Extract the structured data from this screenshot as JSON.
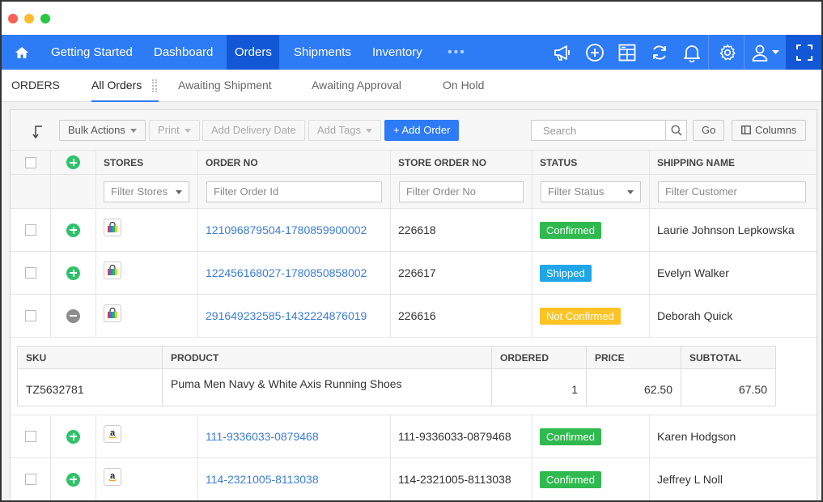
{
  "nav": {
    "items": [
      {
        "label": "Getting Started"
      },
      {
        "label": "Dashboard"
      },
      {
        "label": "Orders"
      },
      {
        "label": "Shipments"
      },
      {
        "label": "Inventory"
      }
    ],
    "more": "•••",
    "active": "Orders",
    "icons": [
      "megaphone-icon",
      "add-circle-icon",
      "calculator-icon",
      "sync-icon",
      "bell-icon",
      "gear-icon",
      "user-icon",
      "fullscreen-icon"
    ],
    "accent": "#2e7bf6",
    "active_bg": "#1257d6"
  },
  "subnav": {
    "title": "ORDERS",
    "tabs": [
      {
        "label": "All Orders"
      },
      {
        "label": "Awaiting Shipment"
      },
      {
        "label": "Awaiting Approval"
      },
      {
        "label": "On Hold"
      }
    ],
    "active": "All Orders"
  },
  "toolbar": {
    "bulk_actions": "Bulk Actions",
    "print": "Print",
    "add_delivery_date": "Add Delivery Date",
    "add_tags": "Add Tags",
    "add_order": "+ Add Order",
    "search_placeholder": "Search",
    "go": "Go",
    "columns": "Columns"
  },
  "table": {
    "headers": [
      "STORES",
      "ORDER NO",
      "STORE ORDER NO",
      "STATUS",
      "SHIPPING NAME"
    ],
    "filters": {
      "stores": "Filter Stores",
      "order_id": "Filter Order Id",
      "order_no": "Filter Order No",
      "status": "Filter Status",
      "customer": "Filter Customer"
    },
    "rows": [
      {
        "store": "shopping-bag-store-icon",
        "order_no": "121096879504-1780859900002",
        "store_order_no": "226618",
        "status": "Confirmed",
        "status_color": "#2fb94f",
        "shipping_name": "Laurie Johnson Lepkowska"
      },
      {
        "store": "shopping-bag-store-icon",
        "order_no": "122456168027-1780850858002",
        "store_order_no": "226617",
        "status": "Shipped",
        "status_color": "#1ea6e8",
        "shipping_name": "Evelyn Walker"
      },
      {
        "store": "shopping-bag-store-icon",
        "order_no": "291649232585-1432224876019",
        "store_order_no": "226616",
        "status": "Not Confirmed",
        "status_color": "#fec325",
        "shipping_name": "Deborah Quick"
      },
      {
        "store": "amazon-store-icon",
        "order_no": "111-9336033-0879468",
        "store_order_no": "111-9336033-0879468",
        "status": "Confirmed",
        "status_color": "#2fb94f",
        "shipping_name": "Karen Hodgson"
      },
      {
        "store": "amazon-store-icon",
        "order_no": "114-2321005-8113038",
        "store_order_no": "114-2321005-8113038",
        "status": "Confirmed",
        "status_color": "#2fb94f",
        "shipping_name": "Jeffrey L Noll"
      }
    ],
    "detail": {
      "headers": [
        "SKU",
        "PRODUCT",
        "ORDERED",
        "PRICE",
        "SUBTOTAL"
      ],
      "row": {
        "sku": "TZ5632781",
        "product": "Puma Men Navy & White Axis Running Shoes",
        "ordered": "1",
        "price": "62.50",
        "subtotal": "67.50"
      }
    }
  }
}
